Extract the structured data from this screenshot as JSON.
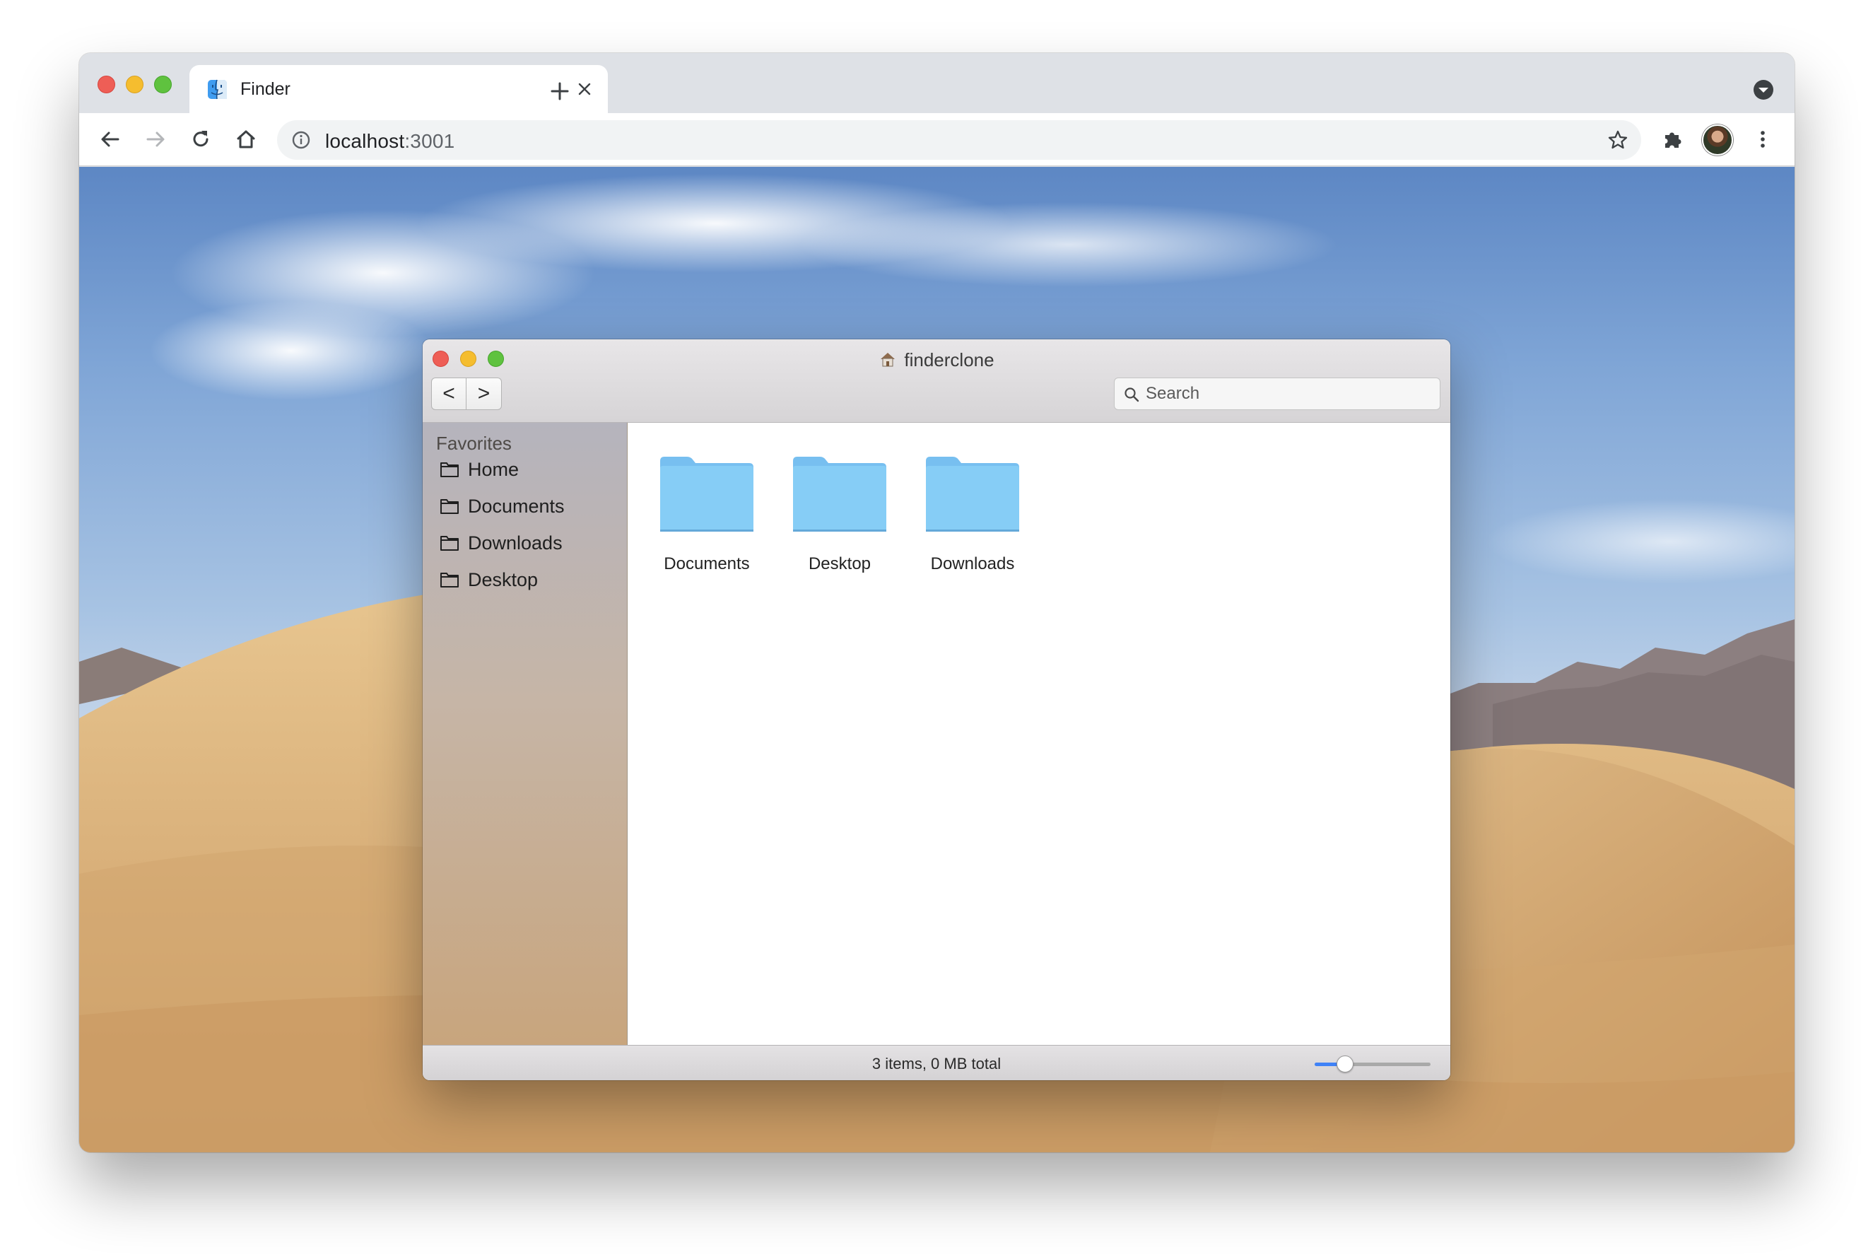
{
  "browser": {
    "tab": {
      "title": "Finder",
      "favicon": "finder-face-icon"
    },
    "new_tab_icon": "plus-icon",
    "tab_search_icon": "chevron-down-circle-icon",
    "url": {
      "host": "localhost",
      "port": ":3001"
    },
    "toolbar_icons": [
      "back-arrow-icon",
      "forward-arrow-icon",
      "reload-icon",
      "home-icon",
      "info-icon",
      "star-icon",
      "extensions-puzzle-icon",
      "avatar",
      "kebab-menu-icon"
    ]
  },
  "finder": {
    "title": "finderclone",
    "title_icon": "home-icon",
    "nav": {
      "back_label": "<",
      "forward_label": ">"
    },
    "search": {
      "placeholder": "Search",
      "value": ""
    },
    "sidebar": {
      "heading": "Favorites",
      "items": [
        {
          "label": "Home",
          "icon": "folder-outline-icon"
        },
        {
          "label": "Documents",
          "icon": "folder-outline-icon"
        },
        {
          "label": "Downloads",
          "icon": "folder-outline-icon"
        },
        {
          "label": "Desktop",
          "icon": "folder-outline-icon"
        }
      ]
    },
    "files": [
      {
        "name": "Documents",
        "icon": "folder-icon"
      },
      {
        "name": "Desktop",
        "icon": "folder-icon"
      },
      {
        "name": "Downloads",
        "icon": "folder-icon"
      }
    ],
    "status": "3 items, 0 MB total",
    "zoom_level": 0.22
  },
  "colors": {
    "folder": "#7fc8f3",
    "folder_tab": "#9ad3f5",
    "accent": "#3f82f7",
    "close": "#ee5e56",
    "minimize": "#f5bd2f",
    "zoom": "#5fc23f"
  }
}
